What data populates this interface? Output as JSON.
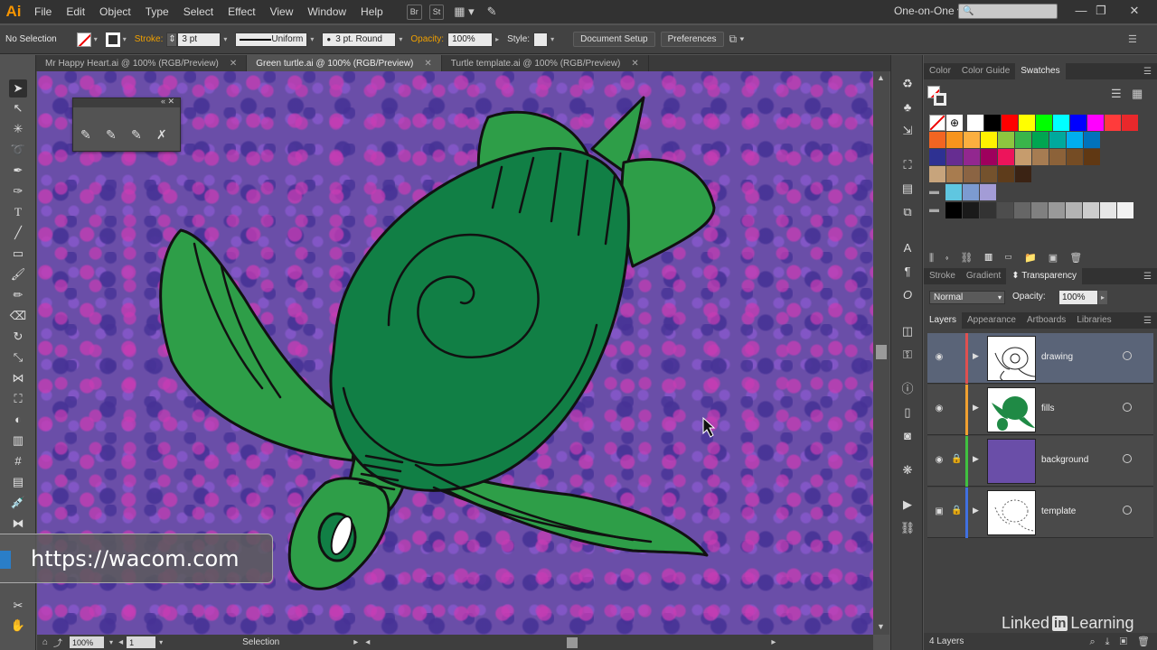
{
  "app": {
    "logo": "Ai"
  },
  "menubar": {
    "items": [
      "File",
      "Edit",
      "Object",
      "Type",
      "Select",
      "Effect",
      "View",
      "Window",
      "Help"
    ],
    "bridge_btn": "Br",
    "stock_btn": "St",
    "workspace": "One-on-One",
    "window_controls": [
      "—",
      "❐",
      "✕"
    ]
  },
  "controlbar": {
    "selection": "No Selection",
    "stroke_label": "Stroke:",
    "stroke_value": "3 pt",
    "profile": "Uniform",
    "brush": "3 pt. Round",
    "opacity_label": "Opacity:",
    "opacity_value": "100%",
    "style_label": "Style:",
    "document_setup": "Document Setup",
    "preferences": "Preferences"
  },
  "doc_tabs": [
    {
      "label": "Mr Happy Heart.ai @ 100% (RGB/Preview)",
      "close": "✕"
    },
    {
      "label": "Green turtle.ai @ 100% (RGB/Preview)",
      "close": "✕"
    },
    {
      "label": "Turtle template.ai @ 100% (RGB/Preview)",
      "close": "✕"
    }
  ],
  "status": {
    "zoom": "100%",
    "artboard": "1",
    "tool": "Selection"
  },
  "overlay": {
    "url": "https://wacom.com"
  },
  "panels": {
    "swatch_tabs": [
      "Color",
      "Color Guide",
      "Swatches"
    ],
    "transparency_tabs": [
      "Stroke",
      "Gradient",
      "⬍ Transparency"
    ],
    "blend_mode": "Normal",
    "opacity_label": "Opacity:",
    "opacity_value": "100%",
    "layers_tabs": [
      "Layers",
      "Appearance",
      "Artboards",
      "Libraries"
    ],
    "layers": [
      {
        "name": "drawing",
        "color": "#e05050",
        "locked": false
      },
      {
        "name": "fills",
        "color": "#f0a030",
        "locked": false
      },
      {
        "name": "background",
        "color": "#40c040",
        "locked": true
      },
      {
        "name": "template",
        "color": "#4070e0",
        "locked": true
      }
    ],
    "layers_count": "4 Layers"
  },
  "watermark": {
    "brand_a": "Linked",
    "brand_in": "in",
    "brand_b": "Learning"
  },
  "swatch_colors": {
    "row1": [
      "#ffffff",
      "#000000",
      "#ff0000",
      "#ffff00",
      "#00ff00",
      "#00ffff",
      "#0000ff",
      "#ff00ff",
      "#ff3b3b",
      "#e8282b"
    ],
    "row2": [
      "#f26522",
      "#f7941d",
      "#fbaf3f",
      "#fff200",
      "#8dc63f",
      "#39b54a",
      "#00a651",
      "#00a99d",
      "#00aeef",
      "#0072bc"
    ],
    "row3": [
      "#2e3192",
      "#662d91",
      "#92278f",
      "#9e005d",
      "#ed145b",
      "#c69c6d",
      "#a67c52",
      "#8c6239",
      "#754c24",
      "#603813"
    ],
    "row4": [
      "#c7a47c",
      "#a87c4f",
      "#8b6443",
      "#74522d",
      "#5e3c1b",
      "#3b2314"
    ],
    "row5": [
      "#5fc6e0",
      "#7c9bd1",
      "#a39cd6"
    ],
    "row6": [
      "#000000",
      "#1a1a1a",
      "#333333",
      "#4d4d4d",
      "#666666",
      "#808080",
      "#999999",
      "#b3b3b3",
      "#cccccc",
      "#e6e6e6",
      "#f2f2f2"
    ]
  }
}
